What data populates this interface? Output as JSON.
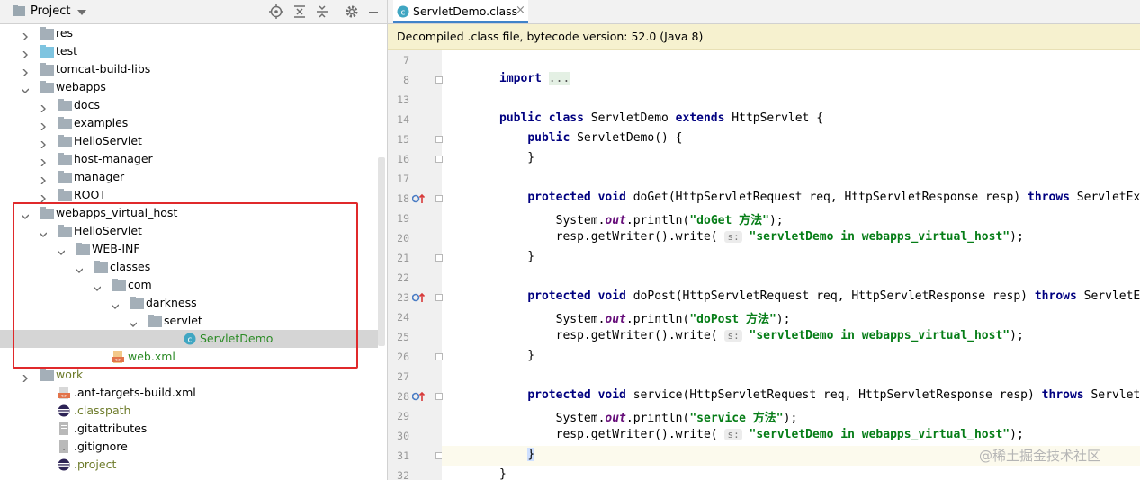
{
  "project_panel": {
    "title": "Project",
    "tree": [
      {
        "label": "res",
        "depth": 1,
        "expanded": false,
        "icon": "folder-icon"
      },
      {
        "label": "test",
        "depth": 1,
        "expanded": false,
        "icon": "folder-test-icon"
      },
      {
        "label": "tomcat-build-libs",
        "depth": 1,
        "expanded": false,
        "icon": "folder-icon"
      },
      {
        "label": "webapps",
        "depth": 1,
        "expanded": true,
        "icon": "folder-icon"
      },
      {
        "label": "docs",
        "depth": 2,
        "expanded": false,
        "icon": "folder-icon"
      },
      {
        "label": "examples",
        "depth": 2,
        "expanded": false,
        "icon": "folder-icon"
      },
      {
        "label": "HelloServlet",
        "depth": 2,
        "expanded": false,
        "icon": "folder-icon"
      },
      {
        "label": "host-manager",
        "depth": 2,
        "expanded": false,
        "icon": "folder-icon"
      },
      {
        "label": "manager",
        "depth": 2,
        "expanded": false,
        "icon": "folder-icon"
      },
      {
        "label": "ROOT",
        "depth": 2,
        "expanded": false,
        "icon": "folder-icon"
      },
      {
        "label": "webapps_virtual_host",
        "depth": 1,
        "expanded": true,
        "icon": "folder-icon"
      },
      {
        "label": "HelloServlet",
        "depth": 2,
        "expanded": true,
        "icon": "folder-icon"
      },
      {
        "label": "WEB-INF",
        "depth": 3,
        "expanded": true,
        "icon": "folder-icon"
      },
      {
        "label": "classes",
        "depth": 4,
        "expanded": true,
        "icon": "folder-icon"
      },
      {
        "label": "com",
        "depth": 5,
        "expanded": true,
        "icon": "folder-icon"
      },
      {
        "label": "darkness",
        "depth": 6,
        "expanded": true,
        "icon": "folder-icon"
      },
      {
        "label": "servlet",
        "depth": 7,
        "expanded": true,
        "icon": "folder-icon"
      },
      {
        "label": "ServletDemo",
        "depth": 9,
        "leaf": true,
        "icon": "class-file-icon",
        "color": "green",
        "selected": true
      },
      {
        "label": "web.xml",
        "depth": 5,
        "leaf": true,
        "icon": "xml-file-icon",
        "color": "green"
      },
      {
        "label": "work",
        "depth": 1,
        "expanded": false,
        "icon": "folder-icon",
        "color": "olive"
      },
      {
        "label": ".ant-targets-build.xml",
        "depth": 2,
        "leaf": true,
        "icon": "ant-xml-icon"
      },
      {
        "label": ".classpath",
        "depth": 2,
        "leaf": true,
        "icon": "eclipse-icon",
        "color": "olive"
      },
      {
        "label": ".gitattributes",
        "depth": 2,
        "leaf": true,
        "icon": "text-file-icon"
      },
      {
        "label": ".gitignore",
        "depth": 2,
        "leaf": true,
        "icon": "gitignore-icon"
      },
      {
        "label": ".project",
        "depth": 2,
        "leaf": true,
        "icon": "eclipse-icon",
        "color": "olive"
      }
    ]
  },
  "editor": {
    "tab_label": "ServletDemo.class",
    "notice": "Decompiled .class file, bytecode version: 52.0 (Java 8)",
    "lines": [
      {
        "n": "7",
        "html": ""
      },
      {
        "n": "8",
        "html": "<span class='kw'>import</span> <span class='dots'>...</span>",
        "fold": true
      },
      {
        "n": "13",
        "html": ""
      },
      {
        "n": "14",
        "html": "<span class='kw'>public class</span> ServletDemo <span class='kw'>extends</span> HttpServlet {"
      },
      {
        "n": "15",
        "html": "    <span class='kw'>public</span> ServletDemo() {",
        "fold": true
      },
      {
        "n": "16",
        "html": "    }",
        "fold": true
      },
      {
        "n": "17",
        "html": ""
      },
      {
        "n": "18",
        "html": "    <span class='kw'>protected void</span> doGet(HttpServletRequest req, HttpServletResponse resp) <span class='kw'>throws</span> ServletException",
        "fold": true,
        "override": true
      },
      {
        "n": "19",
        "html": "        System.<span class='it'>out</span>.println(<span class='st'>\"doGet 方法\"</span>);"
      },
      {
        "n": "20",
        "html": "        resp.getWriter().write( <span class='hint'>s:</span> <span class='st'>\"servletDemo in webapps_virtual_host\"</span>);"
      },
      {
        "n": "21",
        "html": "    }",
        "fold": true
      },
      {
        "n": "22",
        "html": ""
      },
      {
        "n": "23",
        "html": "    <span class='kw'>protected void</span> doPost(HttpServletRequest req, HttpServletResponse resp) <span class='kw'>throws</span> ServletException",
        "fold": true,
        "override": true
      },
      {
        "n": "24",
        "html": "        System.<span class='it'>out</span>.println(<span class='st'>\"doPost 方法\"</span>);"
      },
      {
        "n": "25",
        "html": "        resp.getWriter().write( <span class='hint'>s:</span> <span class='st'>\"servletDemo in webapps_virtual_host\"</span>);"
      },
      {
        "n": "26",
        "html": "    }",
        "fold": true
      },
      {
        "n": "27",
        "html": ""
      },
      {
        "n": "28",
        "html": "    <span class='kw'>protected void</span> service(HttpServletRequest req, HttpServletResponse resp) <span class='kw'>throws</span> ServletException",
        "fold": true,
        "override": true
      },
      {
        "n": "29",
        "html": "        System.<span class='it'>out</span>.println(<span class='st'>\"service 方法\"</span>);"
      },
      {
        "n": "30",
        "html": "        resp.getWriter().write( <span class='hint'>s:</span> <span class='st'>\"servletDemo in webapps_virtual_host\"</span>);"
      },
      {
        "n": "31",
        "html": "    <span class='brace-hl'>}</span>",
        "fold": true
      },
      {
        "n": "32",
        "html": "}"
      }
    ]
  },
  "watermark": "@稀土掘金技术社区",
  "colors": {
    "selection": "#d5d5d5",
    "highlight_box": "#e0292b",
    "notice_bg": "#f6f1cf",
    "keyword": "#000080",
    "string": "#067d17"
  }
}
